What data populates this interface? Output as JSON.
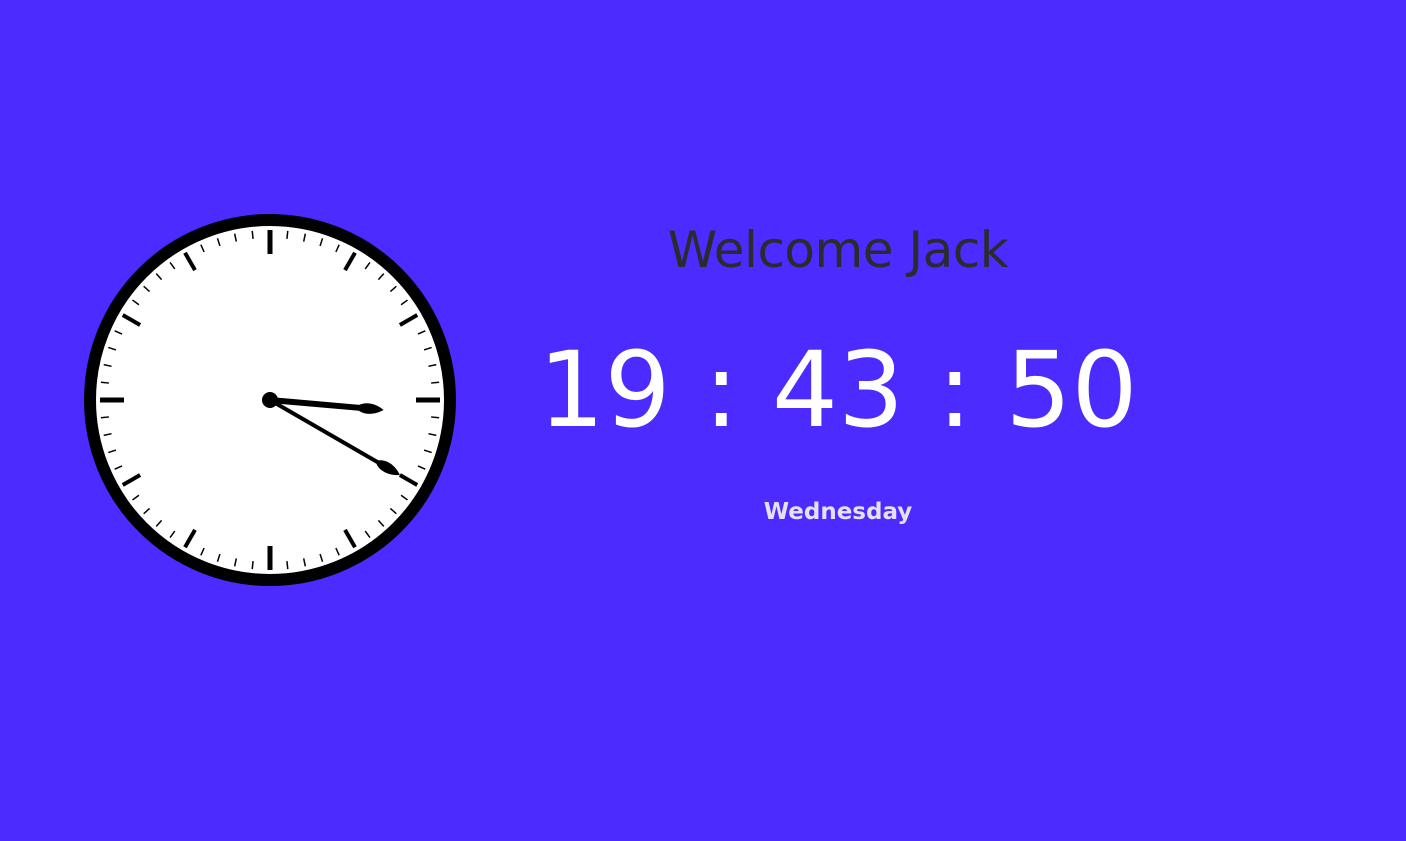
{
  "colors": {
    "background": "#4b2bff",
    "greeting_text": "#2b2b2b",
    "time_text": "#ffffff",
    "day_text": "#e6e1f2",
    "clock_face": "#ffffff",
    "clock_ink": "#000000"
  },
  "welcome": {
    "text": "Welcome Jack"
  },
  "digital_clock": {
    "hours": "19",
    "minutes": "43",
    "seconds": "50",
    "separator": ":"
  },
  "day": {
    "name": "Wednesday"
  },
  "analog_clock": {
    "hour_hand_angle_deg": 95,
    "minute_hand_angle_deg": 120,
    "center_pin_icon": "clock-center-icon"
  }
}
